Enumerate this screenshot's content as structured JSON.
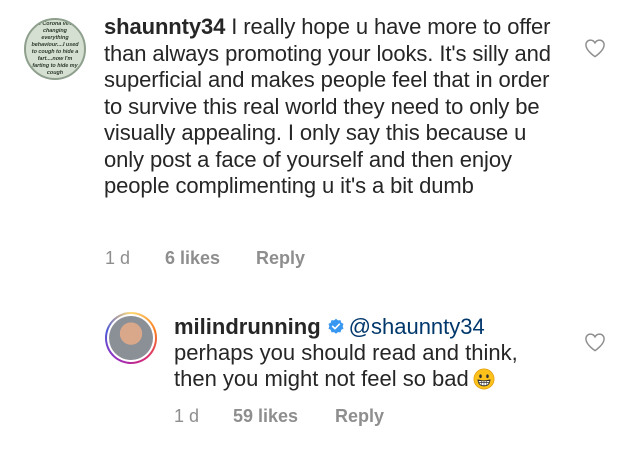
{
  "comments": [
    {
      "username": "shaunnty34",
      "avatar_text": "ris Corona virus changing everything behaviour....I used to cough to hide a fart....now I'm farting to hide my cough",
      "text": " I really hope u have more to offer than always promoting your looks. It's silly and superficial and makes people feel that in order to survive this real world they need to only be visually appealing. I only say this because u only post a face of yourself and then enjoy people complimenting u it's a bit dumb",
      "time": "1 d",
      "likes": "6 likes",
      "reply_label": "Reply",
      "liked": false
    }
  ],
  "reply": {
    "username": "milindrunning",
    "verified": true,
    "mention": "@shaunnty34",
    "text": "perhaps you should read and think, then you might not feel so bad",
    "emoji": "grinning-face-icon",
    "time": "1 d",
    "likes": "59 likes",
    "reply_label": "Reply",
    "liked": false
  },
  "colors": {
    "text": "#262626",
    "muted": "#8e8e8e",
    "verified": "#3897f0",
    "mention": "#00376b"
  }
}
